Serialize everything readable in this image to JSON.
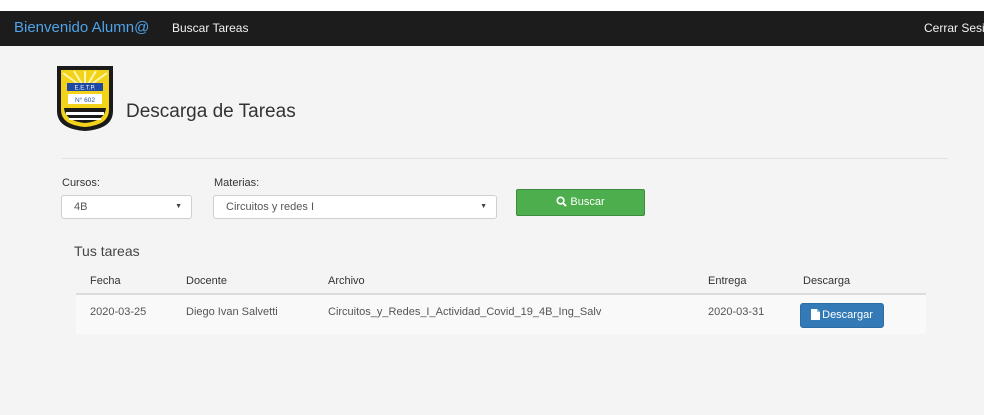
{
  "navbar": {
    "brand": "Bienvenido Alumn@",
    "search_link": "Buscar Tareas",
    "logout": "Cerrar Sesió"
  },
  "page": {
    "title": "Descarga de Tareas",
    "logo_text": "E.E.T.P. N° 602"
  },
  "filters": {
    "cursos_label": "Cursos:",
    "cursos_value": "4B",
    "materias_label": "Materias:",
    "materias_value": "Circuitos y redes I",
    "search_button": "Buscar"
  },
  "tasks": {
    "title": "Tus tareas",
    "columns": [
      "Fecha",
      "Docente",
      "Archivo",
      "Entrega",
      "Descarga"
    ],
    "rows": [
      {
        "fecha": "2020-03-25",
        "docente": "Diego Ivan Salvetti",
        "archivo": "Circuitos_y_Redes_I_Actividad_Covid_19_4B_Ing_Salv",
        "entrega": "2020-03-31",
        "download_label": "Descargar"
      }
    ]
  },
  "colors": {
    "navbar": "#1c1c1c",
    "brand": "#4fa3e8",
    "success": "#4cae4c",
    "primary": "#337ab7"
  },
  "icons": {
    "search_button": "search-icon",
    "download_button": "file-icon"
  }
}
